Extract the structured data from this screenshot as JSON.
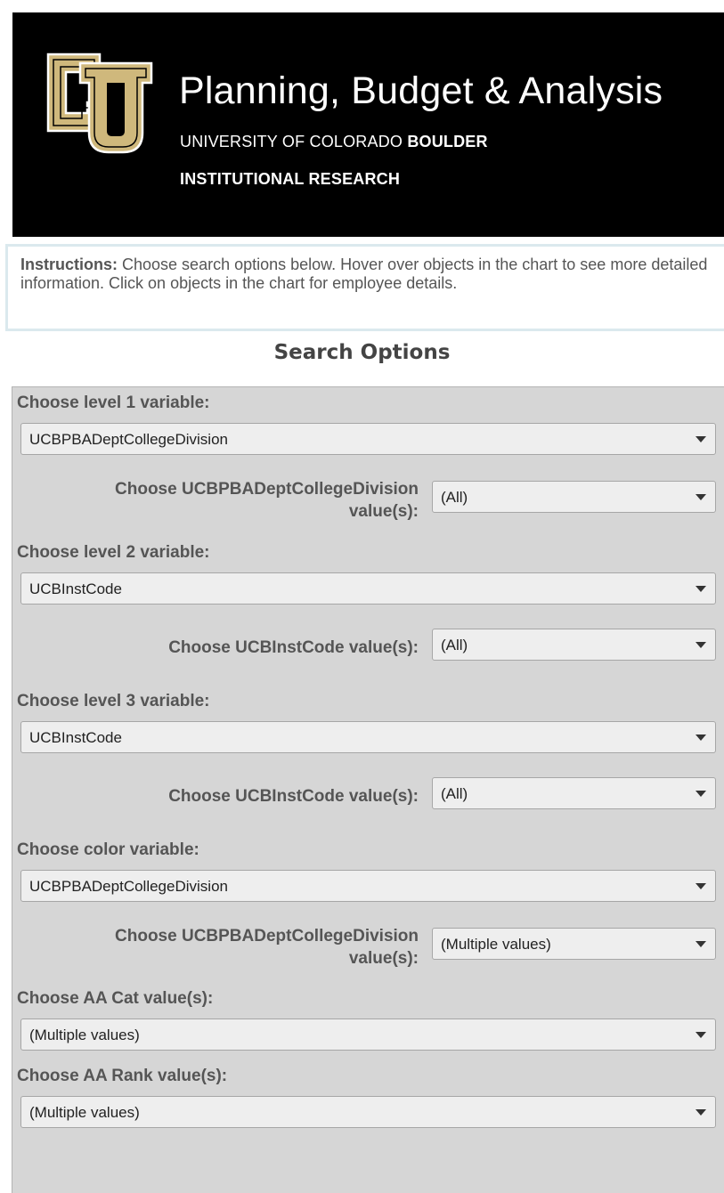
{
  "banner": {
    "title": "Planning, Budget & Analysis",
    "subtitle_regular": "UNIVERSITY OF COLORADO ",
    "subtitle_bold": "BOULDER",
    "subtitle2": "INSTITUTIONAL RESEARCH",
    "logo_text": "CU",
    "colors": {
      "background": "#000000",
      "gold": "#cfb87c",
      "text": "#ffffff"
    }
  },
  "instructions": {
    "label": "Instructions:",
    "text": " Choose search options below.  Hover over objects in the chart to see more detailed information.  Click on objects in the chart for employee details."
  },
  "search": {
    "title": "Search Options",
    "level1": {
      "label": "Choose level 1 variable:",
      "value": "UCBPBADeptCollegeDivision",
      "values_label_line1": "Choose UCBPBADeptCollegeDivision",
      "values_label_line2": "value(s):",
      "values_value": "(All)"
    },
    "level2": {
      "label": "Choose level 2 variable:",
      "value": "UCBInstCode",
      "values_label": "Choose UCBInstCode value(s):",
      "values_value": "(All)"
    },
    "level3": {
      "label": "Choose level 3 variable:",
      "value": "UCBInstCode",
      "values_label": "Choose UCBInstCode value(s):",
      "values_value": "(All)"
    },
    "color": {
      "label": "Choose color variable:",
      "value": "UCBPBADeptCollegeDivision",
      "values_label_line1": "Choose UCBPBADeptCollegeDivision",
      "values_label_line2": "value(s):",
      "values_value": "(Multiple values)"
    },
    "aa_cat": {
      "label": "Choose AA Cat value(s):",
      "value": "(Multiple values)"
    },
    "aa_rank": {
      "label": "Choose AA Rank value(s):",
      "value": "(Multiple values)"
    }
  },
  "icons": {
    "dropdown": "chevron-down-icon",
    "logo": "cu-logo-icon"
  }
}
